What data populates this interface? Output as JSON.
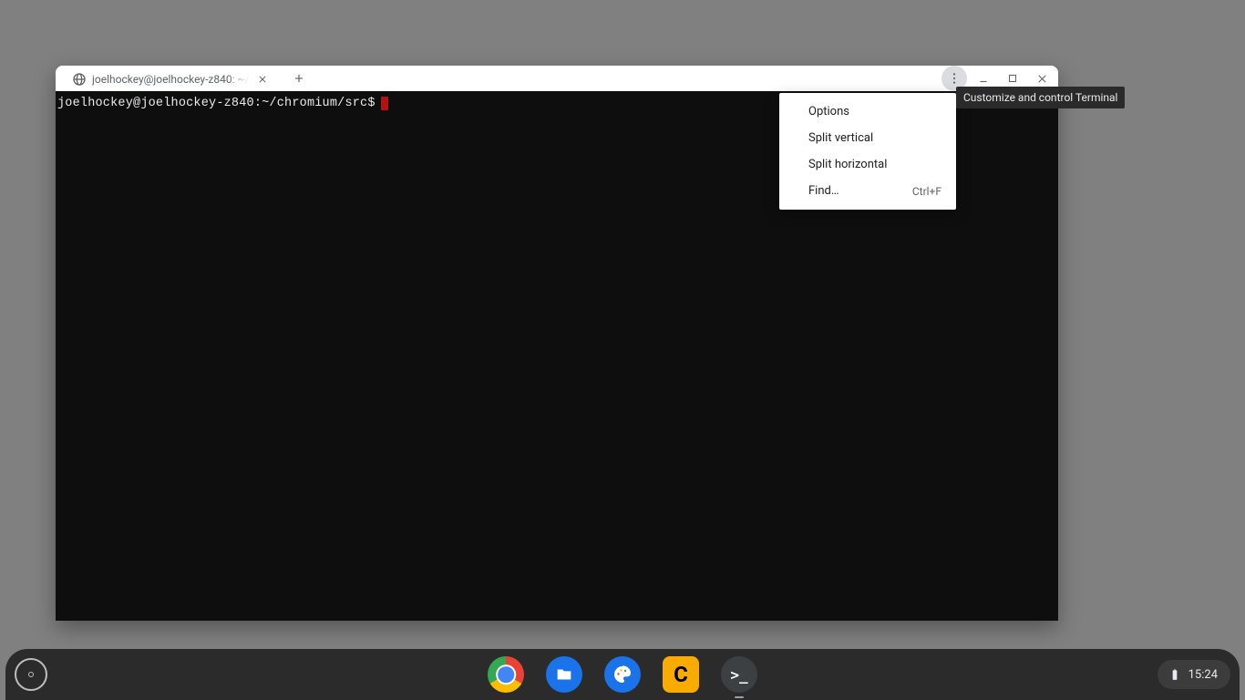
{
  "window": {
    "tab_title": "joelhockey@joelhockey-z840: ~/",
    "tooltip": "Customize and control Terminal"
  },
  "terminal": {
    "prompt": "joelhockey@joelhockey-z840:~/chromium/src$"
  },
  "menu": {
    "options": "Options",
    "split_vertical": "Split vertical",
    "split_horizontal": "Split horizontal",
    "find": "Find…",
    "find_shortcut": "Ctrl+F"
  },
  "shelf": {
    "time": "15:24"
  }
}
